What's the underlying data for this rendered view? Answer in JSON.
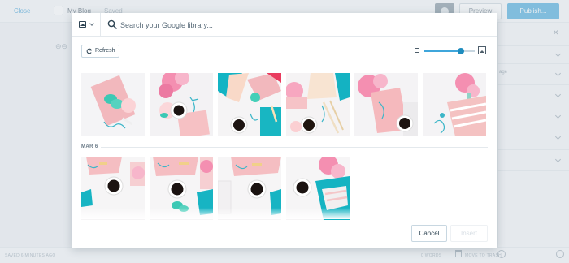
{
  "editor": {
    "close_label": "Close",
    "site_name": "My Blog",
    "saved_label": "Saved",
    "preview_label": "Preview",
    "publish_label": "Publish...",
    "footer_left": "SAVED 6 MINUTES AGO",
    "footer_words": "0 WORDS",
    "trash_label": "MOVE TO TRASH",
    "sidebar_hint": "age"
  },
  "media_modal": {
    "search": {
      "placeholder": "Search your Google library..."
    },
    "refresh_label": "Refresh",
    "zoom_level": 0.72,
    "section_label": "MAR 6",
    "photos_top": [
      {
        "name": "pink-notebook-macarons"
      },
      {
        "name": "peonies-coffee-earbuds"
      },
      {
        "name": "flatlay-teal-notebook"
      },
      {
        "name": "pencils-coffee-flatlay"
      },
      {
        "name": "peony-pink-notebook-coffee"
      },
      {
        "name": "striped-notebook-peony"
      }
    ],
    "photos_mar6": [
      {
        "name": "desk-coffee-pink-1"
      },
      {
        "name": "desk-coffee-macarons"
      },
      {
        "name": "desk-coffee-pink-2"
      },
      {
        "name": "peony-coffee-teal"
      }
    ],
    "cancel_label": "Cancel",
    "insert_label": "Insert"
  },
  "colors": {
    "accent": "#3fa6db",
    "pink": "#f2b8bd",
    "teal": "#00b5ad",
    "peony": "#f48fb1"
  }
}
